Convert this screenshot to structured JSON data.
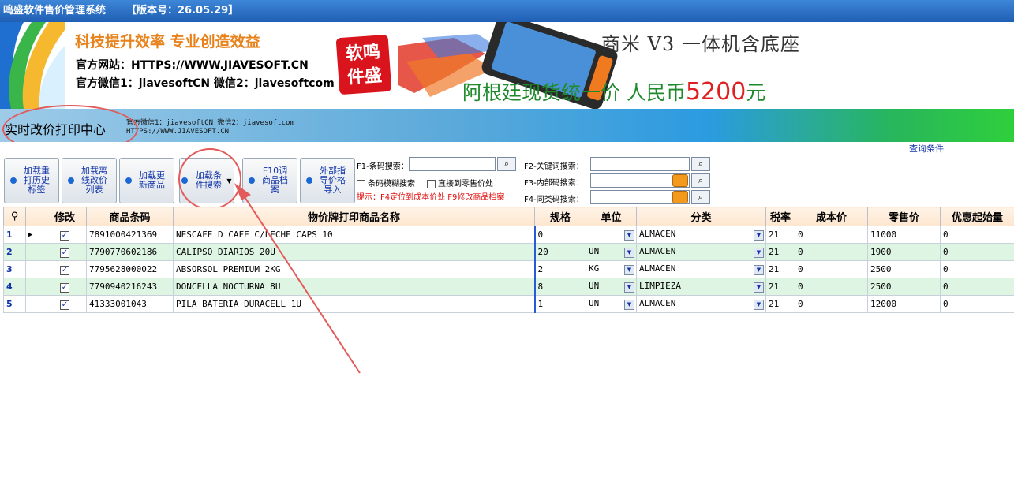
{
  "window": {
    "title": "鸣盛软件售价管理系统",
    "version": "【版本号：26.05.29】"
  },
  "banner": {
    "slogan": "科技提升效率   专业创造效益",
    "website": "官方网站：HTTPS://WWW.JIAVESOFT.CN",
    "wechat": "官方微信1：jiavesoftCN  微信2：jiavesoftcom",
    "seal_text": "软鸣件盛",
    "ad_title": "商米 V3   一体机含底座",
    "ad_text": "阿根廷现货统一价  人民币",
    "ad_price": "5200",
    "ad_unit": "元"
  },
  "header": {
    "center_title": "实时改价打印中心",
    "info_line1": "官方微信1：jiavesoftCN  微信2：jiavesoftcom",
    "info_line2": "HTTPS://WWW.JIAVESOFT.CN"
  },
  "toolbar": {
    "query_conditions": "查询条件",
    "buttons": [
      {
        "label": "加载重打历史标签"
      },
      {
        "label": "加载离线改价列表"
      },
      {
        "label": "加载更新商品"
      },
      {
        "label": "加载条件搜索"
      },
      {
        "label": "F10调商品档案"
      },
      {
        "label": "外部指导价格导入"
      }
    ],
    "search": {
      "barcode_label": "F1-条码搜索：",
      "keyword_label": "F2-关键词搜索：",
      "internal_label": "F3-内部码搜索：",
      "sametype_label": "F4-同类码搜索：",
      "fuzzy_label": "条码模糊搜索",
      "direct_label": "直接到零售价处",
      "hint": "提示：F4定位到成本价处 F9修改商品档案"
    }
  },
  "grid": {
    "columns": [
      "修改",
      "商品条码",
      "物价牌打印商品名称",
      "规格",
      "单位",
      "分类",
      "税率",
      "成本价",
      "零售价",
      "优惠起始量"
    ],
    "rows": [
      {
        "num": "1",
        "checked": "✓",
        "barcode": "7891000421369",
        "name": "NESCAFE D CAFE C/LECHE CAPS 10",
        "spec": "0",
        "unit": "",
        "category": "ALMACEN",
        "tax": "21",
        "cost": "0",
        "price": "11000",
        "discount": "0"
      },
      {
        "num": "2",
        "checked": "✓",
        "barcode": "7790770602186",
        "name": "CALIPSO DIARIOS 20U",
        "spec": "20",
        "unit": "UN",
        "category": "ALMACEN",
        "tax": "21",
        "cost": "0",
        "price": "1900",
        "discount": "0"
      },
      {
        "num": "3",
        "checked": "✓",
        "barcode": "7795628000022",
        "name": "ABSORSOL PREMIUM 2KG",
        "spec": "2",
        "unit": "KG",
        "category": "ALMACEN",
        "tax": "21",
        "cost": "0",
        "price": "2500",
        "discount": "0"
      },
      {
        "num": "4",
        "checked": "✓",
        "barcode": "7790940216243",
        "name": "DONCELLA NOCTURNA 8U",
        "spec": "8",
        "unit": "UN",
        "category": "LIMPIEZA",
        "tax": "21",
        "cost": "0",
        "price": "2500",
        "discount": "0"
      },
      {
        "num": "5",
        "checked": "✓",
        "barcode": "41333001043",
        "name": "PILA BATERIA DURACELL 1U",
        "spec": "1",
        "unit": "UN",
        "category": "ALMACEN",
        "tax": "21",
        "cost": "0",
        "price": "12000",
        "discount": "0"
      }
    ]
  },
  "icons": {
    "search": "magnifier-icon",
    "dropdown": "chevron-down-icon",
    "row_pointer": "triangle-right-icon"
  }
}
